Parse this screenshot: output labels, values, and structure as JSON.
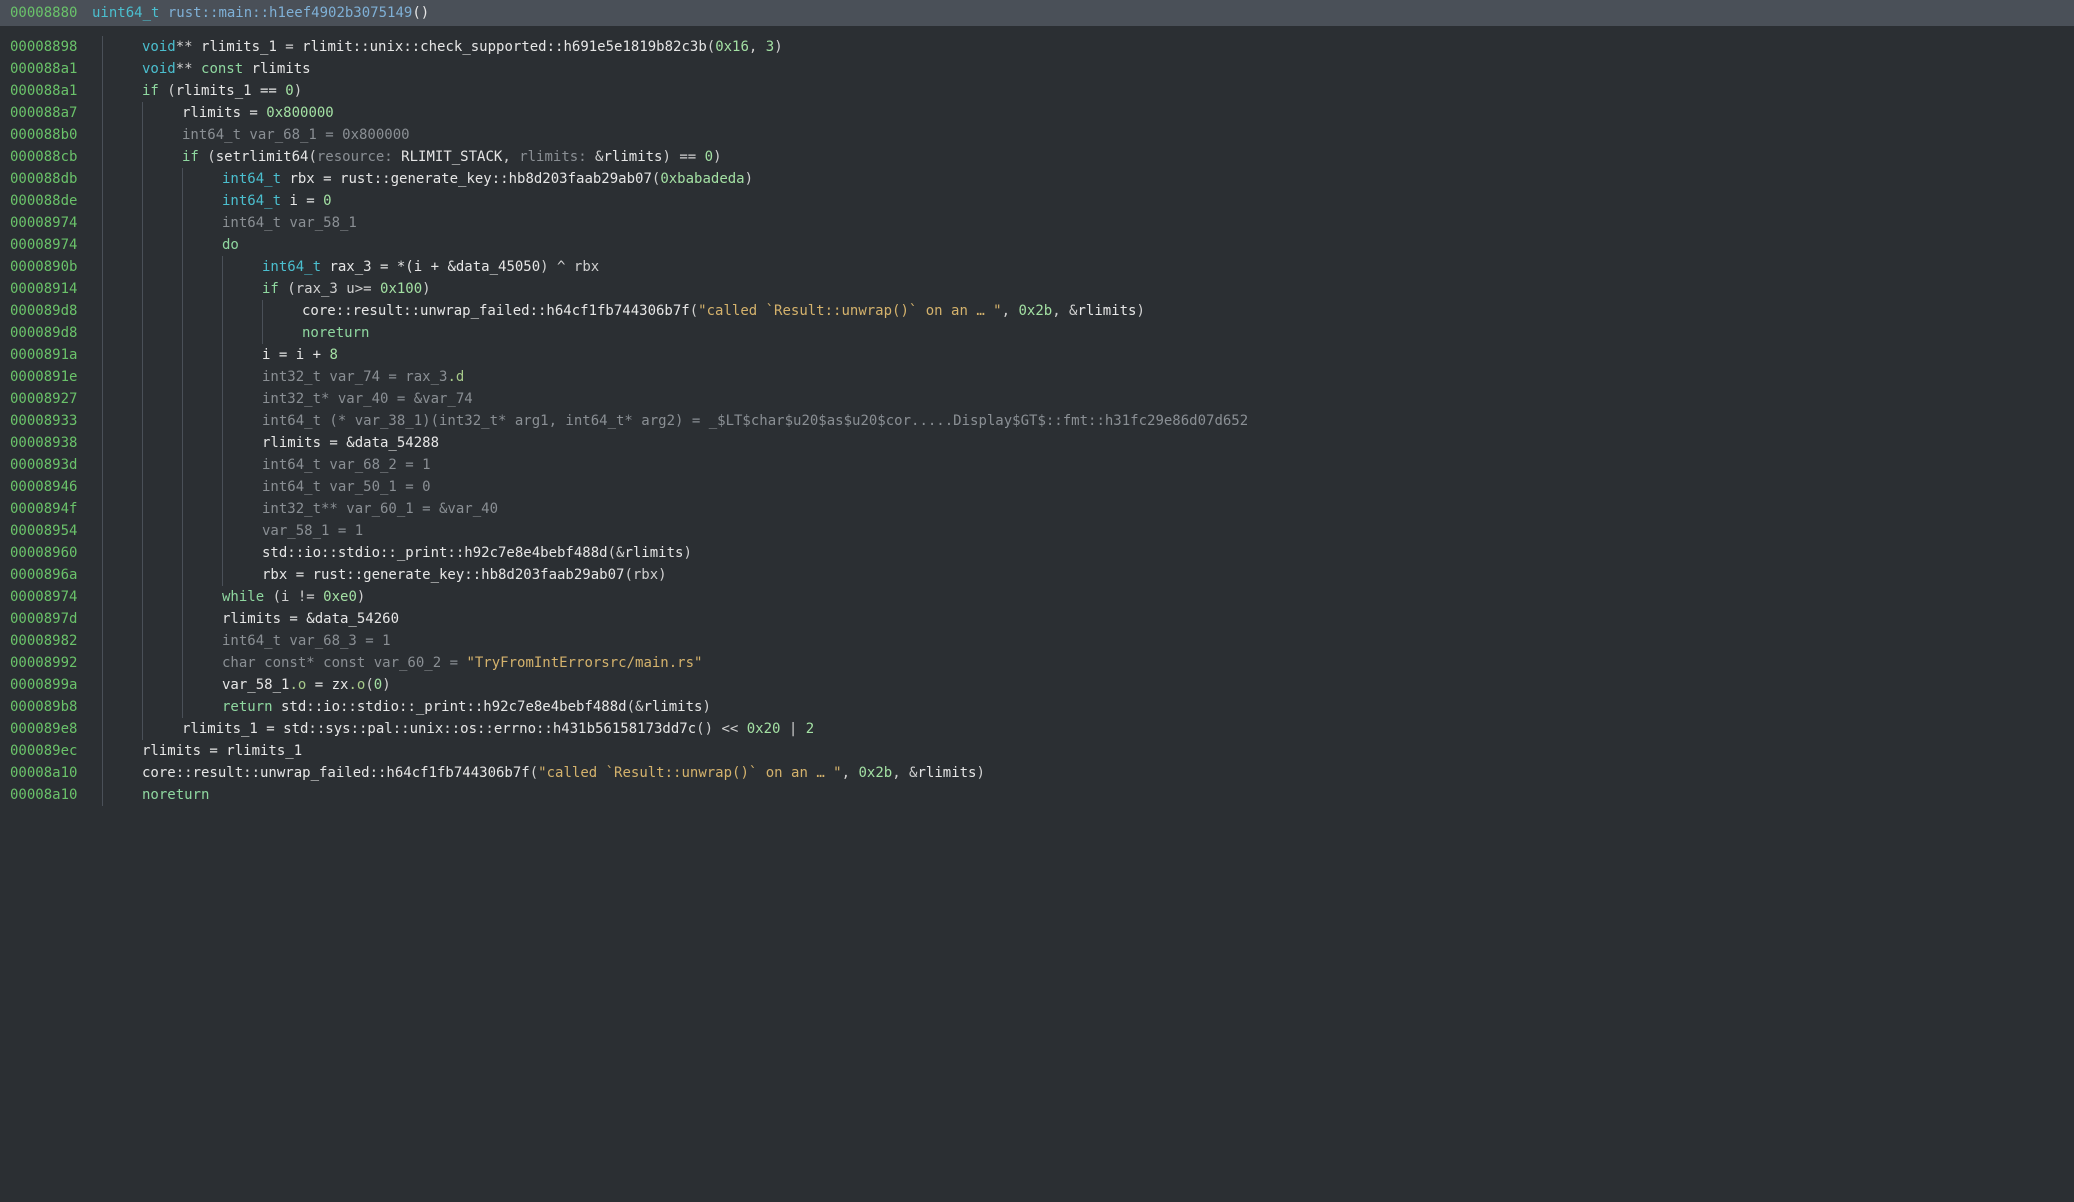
{
  "header": {
    "addr": "00008880",
    "type": "uint64_t",
    "func": "rust::main::h1eef4902b3075149",
    "paren": "()"
  },
  "lines": [
    {
      "addr": "00008898",
      "indent": 40,
      "tokens": [
        {
          "c": "t-type",
          "t": "void"
        },
        {
          "c": "t-op",
          "t": "** "
        },
        {
          "c": "t-light",
          "t": "rlimits_1"
        },
        {
          "c": "t-op",
          "t": " = "
        },
        {
          "c": "t-light",
          "t": "rlimit::unix::check_supported::h691e5e1819b82c3b"
        },
        {
          "c": "t-op",
          "t": "("
        },
        {
          "c": "t-num",
          "t": "0x16"
        },
        {
          "c": "t-op",
          "t": ", "
        },
        {
          "c": "t-num",
          "t": "3"
        },
        {
          "c": "t-op",
          "t": ")"
        }
      ]
    },
    {
      "addr": "000088a1",
      "indent": 40,
      "tokens": [
        {
          "c": "t-type",
          "t": "void"
        },
        {
          "c": "t-op",
          "t": "** "
        },
        {
          "c": "t-kw",
          "t": "const"
        },
        {
          "c": "t-light",
          "t": " rlimits"
        }
      ]
    },
    {
      "addr": "000088a1",
      "indent": 40,
      "tokens": [
        {
          "c": "t-kw",
          "t": "if"
        },
        {
          "c": "t-op",
          "t": " ("
        },
        {
          "c": "t-light",
          "t": "rlimits_1 == "
        },
        {
          "c": "t-num",
          "t": "0"
        },
        {
          "c": "t-op",
          "t": ")"
        }
      ]
    },
    {
      "addr": "000088a7",
      "indent": 80,
      "tokens": [
        {
          "c": "t-light",
          "t": "rlimits = "
        },
        {
          "c": "t-num",
          "t": "0x800000"
        }
      ]
    },
    {
      "addr": "000088b0",
      "indent": 80,
      "tokens": [
        {
          "c": "t-comment",
          "t": "int64_t var_68_1 = 0x800000"
        }
      ]
    },
    {
      "addr": "000088cb",
      "indent": 80,
      "tokens": [
        {
          "c": "t-kw",
          "t": "if"
        },
        {
          "c": "t-op",
          "t": " ("
        },
        {
          "c": "t-light",
          "t": "setrlimit64"
        },
        {
          "c": "t-op",
          "t": "("
        },
        {
          "c": "t-comment",
          "t": "resource: "
        },
        {
          "c": "t-light",
          "t": "RLIMIT_STACK"
        },
        {
          "c": "t-op",
          "t": ", "
        },
        {
          "c": "t-comment",
          "t": "rlimits: "
        },
        {
          "c": "t-op",
          "t": "&"
        },
        {
          "c": "t-light",
          "t": "rlimits"
        },
        {
          "c": "t-op",
          "t": ") == "
        },
        {
          "c": "t-num",
          "t": "0"
        },
        {
          "c": "t-op",
          "t": ")"
        }
      ]
    },
    {
      "addr": "000088db",
      "indent": 120,
      "tokens": [
        {
          "c": "t-type",
          "t": "int64_t"
        },
        {
          "c": "t-light",
          "t": " rbx = rust::generate_key::hb8d203faab29ab07"
        },
        {
          "c": "t-op",
          "t": "("
        },
        {
          "c": "t-num",
          "t": "0xbabadeda"
        },
        {
          "c": "t-op",
          "t": ")"
        }
      ]
    },
    {
      "addr": "000088de",
      "indent": 120,
      "tokens": [
        {
          "c": "t-type",
          "t": "int64_t"
        },
        {
          "c": "t-light",
          "t": " i = "
        },
        {
          "c": "t-num",
          "t": "0"
        }
      ]
    },
    {
      "addr": "00008974",
      "indent": 120,
      "tokens": [
        {
          "c": "t-comment",
          "t": "int64_t var_58_1"
        }
      ]
    },
    {
      "addr": "00008974",
      "indent": 120,
      "tokens": [
        {
          "c": "t-kw",
          "t": "do"
        }
      ]
    },
    {
      "addr": "0000890b",
      "indent": 160,
      "tokens": [
        {
          "c": "t-type",
          "t": "int64_t"
        },
        {
          "c": "t-light",
          "t": " rax_3 = *(i + &"
        },
        {
          "c": "t-light",
          "t": "data_45050"
        },
        {
          "c": "t-op",
          "t": ") ^ rbx"
        }
      ]
    },
    {
      "addr": "00008914",
      "indent": 160,
      "tokens": [
        {
          "c": "t-kw",
          "t": "if"
        },
        {
          "c": "t-op",
          "t": " (rax_3 u>= "
        },
        {
          "c": "t-num",
          "t": "0x100"
        },
        {
          "c": "t-op",
          "t": ")"
        }
      ]
    },
    {
      "addr": "000089d8",
      "indent": 200,
      "tokens": [
        {
          "c": "t-light",
          "t": "core::result::unwrap_failed::h64cf1fb744306b7f"
        },
        {
          "c": "t-op",
          "t": "("
        },
        {
          "c": "t-str",
          "t": "\"called `Result::unwrap()` on an … \""
        },
        {
          "c": "t-op",
          "t": ", "
        },
        {
          "c": "t-num",
          "t": "0x2b"
        },
        {
          "c": "t-op",
          "t": ", &"
        },
        {
          "c": "t-light",
          "t": "rlimits"
        },
        {
          "c": "t-op",
          "t": ")"
        }
      ]
    },
    {
      "addr": "000089d8",
      "indent": 200,
      "tokens": [
        {
          "c": "t-kw",
          "t": "noreturn"
        }
      ]
    },
    {
      "addr": "0000891a",
      "indent": 160,
      "tokens": [
        {
          "c": "t-light",
          "t": "i = i + "
        },
        {
          "c": "t-num",
          "t": "8"
        }
      ]
    },
    {
      "addr": "0000891e",
      "indent": 160,
      "tokens": [
        {
          "c": "t-comment",
          "t": "int32_t var_74 = rax_3"
        },
        {
          "c": "t-field",
          "t": ".d"
        }
      ]
    },
    {
      "addr": "00008927",
      "indent": 160,
      "tokens": [
        {
          "c": "t-comment",
          "t": "int32_t* var_40 = &var_74"
        }
      ]
    },
    {
      "addr": "00008933",
      "indent": 160,
      "tokens": [
        {
          "c": "t-comment",
          "t": "int64_t (* var_38_1)(int32_t* arg1, int64_t* arg2) = _$LT$char$u20$as$u20$cor.....Display$GT$::fmt::h31fc29e86d07d652"
        }
      ]
    },
    {
      "addr": "00008938",
      "indent": 160,
      "tokens": [
        {
          "c": "t-light",
          "t": "rlimits = &"
        },
        {
          "c": "t-light",
          "t": "data_54288"
        }
      ]
    },
    {
      "addr": "0000893d",
      "indent": 160,
      "tokens": [
        {
          "c": "t-comment",
          "t": "int64_t var_68_2 = 1"
        }
      ]
    },
    {
      "addr": "00008946",
      "indent": 160,
      "tokens": [
        {
          "c": "t-comment",
          "t": "int64_t var_50_1 = 0"
        }
      ]
    },
    {
      "addr": "0000894f",
      "indent": 160,
      "tokens": [
        {
          "c": "t-comment",
          "t": "int32_t** var_60_1 = &var_40"
        }
      ]
    },
    {
      "addr": "00008954",
      "indent": 160,
      "tokens": [
        {
          "c": "t-comment",
          "t": "var_58_1 = 1"
        }
      ]
    },
    {
      "addr": "00008960",
      "indent": 160,
      "tokens": [
        {
          "c": "t-light",
          "t": "std::io::stdio::_print::h92c7e8e4bebf488d"
        },
        {
          "c": "t-op",
          "t": "(&"
        },
        {
          "c": "t-light",
          "t": "rlimits"
        },
        {
          "c": "t-op",
          "t": ")"
        }
      ]
    },
    {
      "addr": "0000896a",
      "indent": 160,
      "tokens": [
        {
          "c": "t-light",
          "t": "rbx = rust::generate_key::hb8d203faab29ab07"
        },
        {
          "c": "t-op",
          "t": "(rbx)"
        }
      ]
    },
    {
      "addr": "00008974",
      "indent": 120,
      "tokens": [
        {
          "c": "t-kw",
          "t": "while"
        },
        {
          "c": "t-op",
          "t": " (i != "
        },
        {
          "c": "t-num",
          "t": "0xe0"
        },
        {
          "c": "t-op",
          "t": ")"
        }
      ]
    },
    {
      "addr": "0000897d",
      "indent": 120,
      "tokens": [
        {
          "c": "t-light",
          "t": "rlimits = &"
        },
        {
          "c": "t-light",
          "t": "data_54260"
        }
      ]
    },
    {
      "addr": "00008982",
      "indent": 120,
      "tokens": [
        {
          "c": "t-comment",
          "t": "int64_t var_68_3 = 1"
        }
      ]
    },
    {
      "addr": "00008992",
      "indent": 120,
      "tokens": [
        {
          "c": "t-comment",
          "t": "char const* const var_60_2 = "
        },
        {
          "c": "t-str",
          "t": "\"TryFromIntErrorsrc/main.rs\""
        }
      ]
    },
    {
      "addr": "0000899a",
      "indent": 120,
      "tokens": [
        {
          "c": "t-light",
          "t": "var_58_1"
        },
        {
          "c": "t-field",
          "t": ".o"
        },
        {
          "c": "t-light",
          "t": " = zx"
        },
        {
          "c": "t-field",
          "t": ".o"
        },
        {
          "c": "t-op",
          "t": "("
        },
        {
          "c": "t-num",
          "t": "0"
        },
        {
          "c": "t-op",
          "t": ")"
        }
      ]
    },
    {
      "addr": "000089b8",
      "indent": 120,
      "tokens": [
        {
          "c": "t-kw",
          "t": "return"
        },
        {
          "c": "t-light",
          "t": " std::io::stdio::_print::h92c7e8e4bebf488d"
        },
        {
          "c": "t-op",
          "t": "(&"
        },
        {
          "c": "t-light",
          "t": "rlimits"
        },
        {
          "c": "t-op",
          "t": ")"
        }
      ]
    },
    {
      "addr": "000089e8",
      "indent": 80,
      "tokens": [
        {
          "c": "t-light",
          "t": "rlimits_1 = std::sys::pal::unix::os::errno::h431b56158173dd7c"
        },
        {
          "c": "t-op",
          "t": "() << "
        },
        {
          "c": "t-num",
          "t": "0x20"
        },
        {
          "c": "t-op",
          "t": " | "
        },
        {
          "c": "t-num",
          "t": "2"
        }
      ]
    },
    {
      "addr": "000089ec",
      "indent": 40,
      "tokens": [
        {
          "c": "t-light",
          "t": "rlimits = rlimits_1"
        }
      ]
    },
    {
      "addr": "00008a10",
      "indent": 40,
      "tokens": [
        {
          "c": "t-light",
          "t": "core::result::unwrap_failed::h64cf1fb744306b7f"
        },
        {
          "c": "t-op",
          "t": "("
        },
        {
          "c": "t-str",
          "t": "\"called `Result::unwrap()` on an … \""
        },
        {
          "c": "t-op",
          "t": ", "
        },
        {
          "c": "t-num",
          "t": "0x2b"
        },
        {
          "c": "t-op",
          "t": ", &"
        },
        {
          "c": "t-light",
          "t": "rlimits"
        },
        {
          "c": "t-op",
          "t": ")"
        }
      ]
    },
    {
      "addr": "00008a10",
      "indent": 40,
      "tokens": [
        {
          "c": "t-kw",
          "t": "noreturn"
        }
      ]
    }
  ]
}
